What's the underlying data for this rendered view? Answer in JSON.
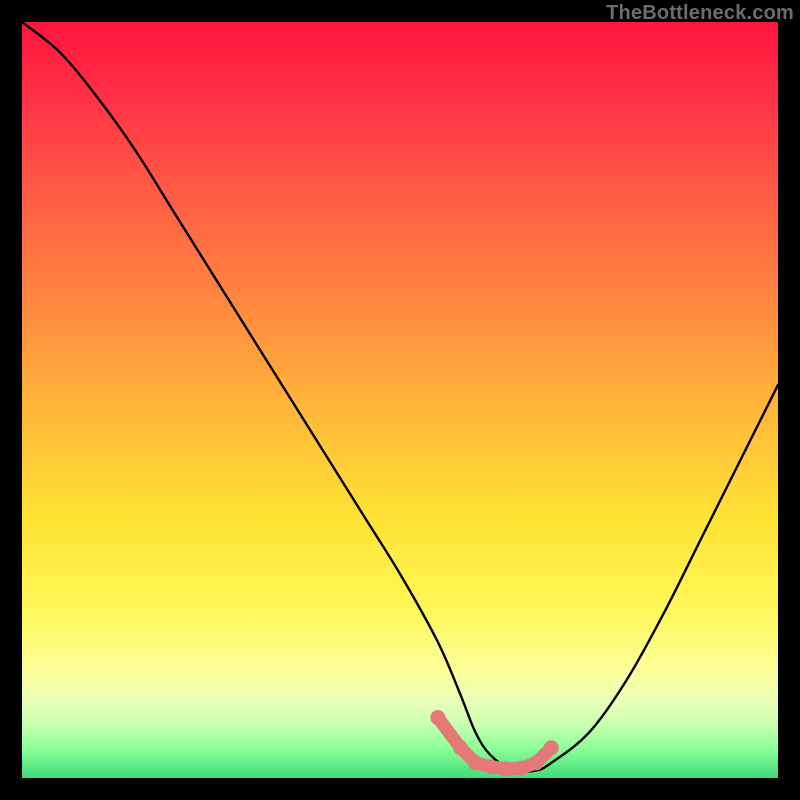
{
  "watermark": "TheBottleneck.com",
  "colors": {
    "background": "#000000",
    "curve": "#000000",
    "marker": "#e47a78",
    "gradient_stops": [
      "#ff163e",
      "#ff5a45",
      "#ffb93a",
      "#ffe335",
      "#fbff9c",
      "#3fdd7b"
    ]
  },
  "chart_data": {
    "type": "line",
    "title": "",
    "xlabel": "",
    "ylabel": "",
    "xlim": [
      0,
      100
    ],
    "ylim": [
      0,
      100
    ],
    "series": [
      {
        "name": "bottleneck-curve",
        "x": [
          0,
          5,
          10,
          15,
          20,
          25,
          30,
          35,
          40,
          45,
          50,
          55,
          58,
          60,
          62,
          65,
          68,
          70,
          75,
          80,
          85,
          90,
          95,
          100
        ],
        "values": [
          100,
          96,
          90,
          83,
          75,
          67,
          59,
          51,
          43,
          35,
          27,
          18,
          11,
          6,
          3,
          1,
          1,
          2,
          6,
          13,
          22,
          32,
          42,
          52
        ]
      }
    ],
    "markers": {
      "name": "highlighted-range",
      "x": [
        55,
        58,
        60,
        62,
        64,
        66,
        68,
        70
      ],
      "values": [
        8,
        4,
        2,
        1.5,
        1.2,
        1.3,
        2,
        4
      ]
    }
  }
}
